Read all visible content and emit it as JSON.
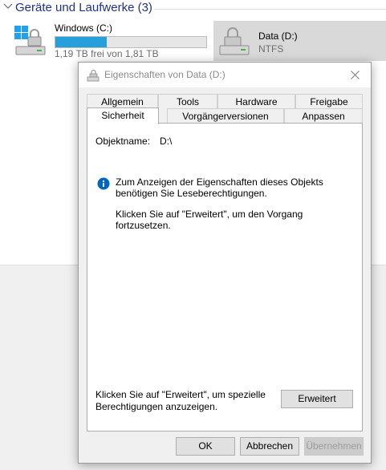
{
  "explorer": {
    "group_title": "Geräte und Laufwerke (3)",
    "drives": [
      {
        "name": "Windows (C:)",
        "free_text": "1,19 TB frei von 1,81 TB",
        "used_fraction": 0.34
      },
      {
        "name": "Data (D:)",
        "filesystem": "NTFS"
      }
    ]
  },
  "dialog": {
    "title": "Eigenschaften von Data (D:)",
    "tabs_row1": [
      "Allgemein",
      "Tools",
      "Hardware",
      "Freigabe"
    ],
    "tabs_row2": [
      "Sicherheit",
      "Vorgängerversionen",
      "Anpassen"
    ],
    "active_tab": "Sicherheit",
    "object_label": "Objektname:",
    "object_value": "D:\\",
    "info_text": "Zum Anzeigen der Eigenschaften dieses Objekts benötigen Sie Leseberechtigungen.",
    "hint_text": "Klicken Sie auf \"Erweitert\", um den Vorgang fortzusetzen.",
    "advanced_hint": "Klicken Sie auf \"Erweitert\", um spezielle Berechtigungen anzuzeigen.",
    "buttons": {
      "advanced": "Erweitert",
      "ok": "OK",
      "cancel": "Abbrechen",
      "apply": "Übernehmen"
    }
  },
  "colors": {
    "accent": "#26a0da",
    "info": "#0067c0",
    "group_title": "#1e3287"
  }
}
